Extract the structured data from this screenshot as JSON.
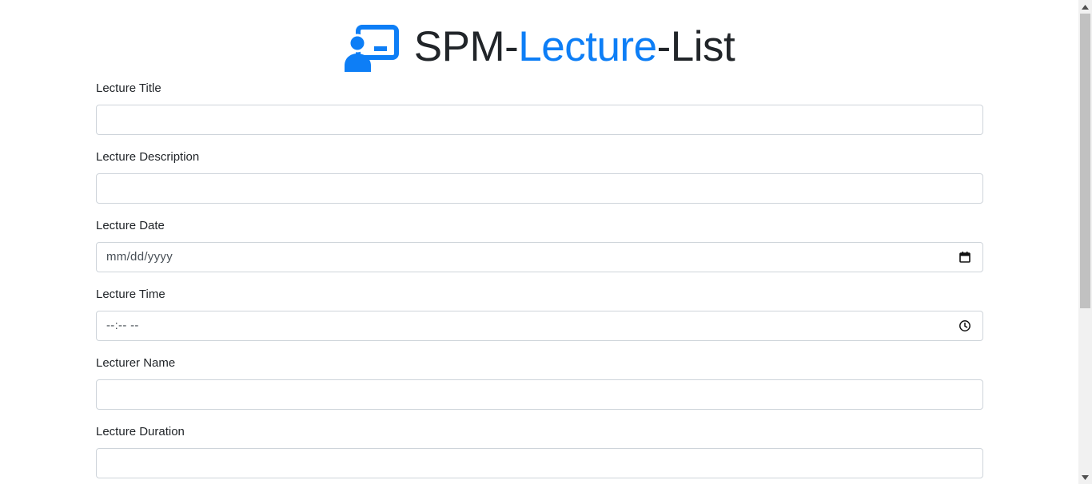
{
  "header": {
    "title_part1": "SPM-",
    "title_part2": "Lecture",
    "title_part3": "-List",
    "logo_icon": "chalkboard-teacher-icon",
    "accent_color": "#0d7ef6"
  },
  "form": {
    "fields": [
      {
        "label": "Lecture Title",
        "type": "text",
        "placeholder": ""
      },
      {
        "label": "Lecture Description",
        "type": "text",
        "placeholder": ""
      },
      {
        "label": "Lecture Date",
        "type": "date",
        "placeholder": "mm/dd/yyyy",
        "icon": "calendar-icon"
      },
      {
        "label": "Lecture Time",
        "type": "time",
        "placeholder": "--:-- --",
        "icon": "clock-icon"
      },
      {
        "label": "Lecturer Name",
        "type": "text",
        "placeholder": ""
      },
      {
        "label": "Lecture Duration",
        "type": "text",
        "placeholder": ""
      }
    ]
  }
}
